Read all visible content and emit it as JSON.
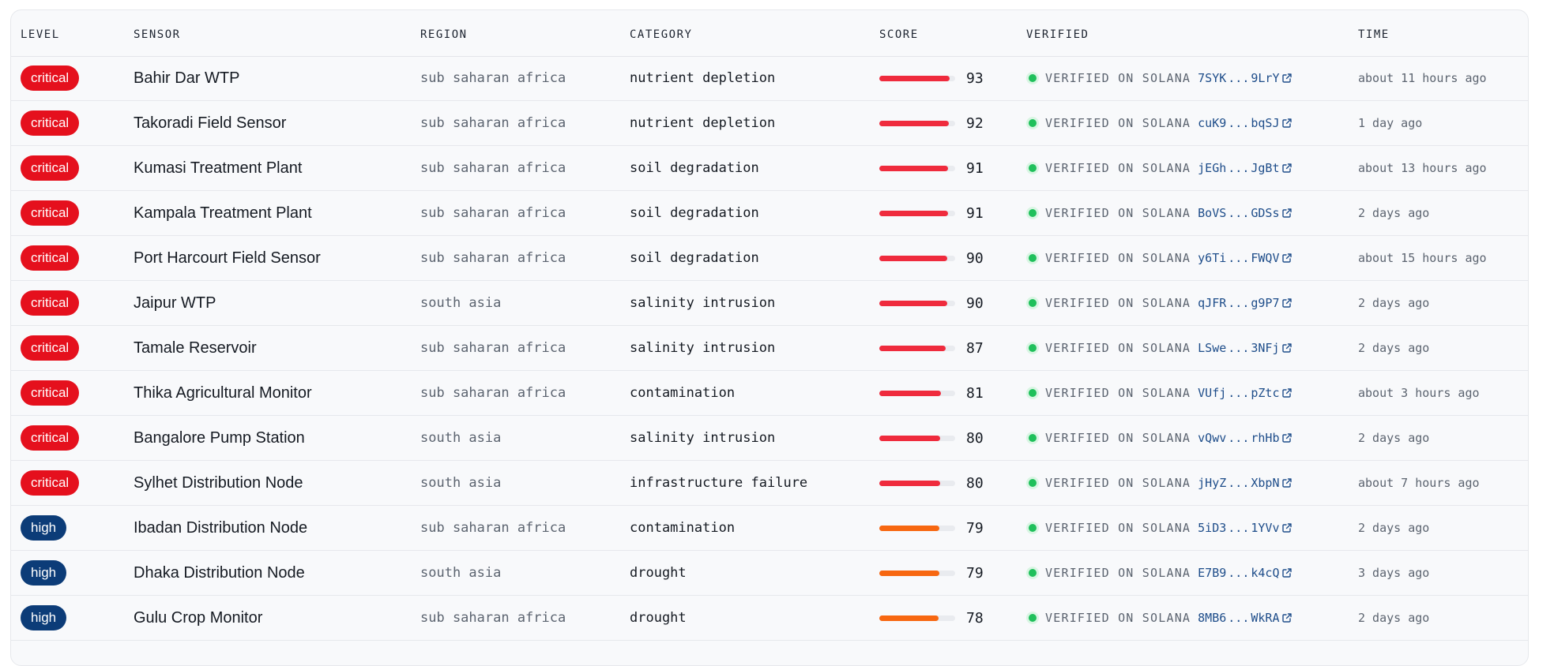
{
  "headers": {
    "level": "LEVEL",
    "sensor": "SENSOR",
    "region": "REGION",
    "category": "CATEGORY",
    "score": "SCORE",
    "verified": "VERIFIED",
    "time": "TIME"
  },
  "colors": {
    "critical_badge": "#e5101d",
    "high_badge": "#0c3c78",
    "critical_bar": "#ef2b3d",
    "high_bar": "#f76711",
    "verified_dot": "#1fc05b",
    "hash_link": "#1e4d8a"
  },
  "rows": [
    {
      "level": "critical",
      "sensor": "Bahir Dar WTP",
      "region": "sub saharan africa",
      "category": "nutrient depletion",
      "score": "93",
      "score_value": 93,
      "verified": "VERIFIED ON SOLANA",
      "hash_start": "7SYK",
      "hash_sep": "...",
      "hash_end": "9LrY",
      "link_icon": "external-link-icon",
      "time": "about 11 hours ago"
    },
    {
      "level": "critical",
      "sensor": "Takoradi Field Sensor",
      "region": "sub saharan africa",
      "category": "nutrient depletion",
      "score": "92",
      "score_value": 92,
      "verified": "VERIFIED ON SOLANA",
      "hash_start": "cuK9",
      "hash_sep": "...",
      "hash_end": "bqSJ",
      "link_icon": "external-link-icon",
      "time": "1 day ago"
    },
    {
      "level": "critical",
      "sensor": "Kumasi Treatment Plant",
      "region": "sub saharan africa",
      "category": "soil degradation",
      "score": "91",
      "score_value": 91,
      "verified": "VERIFIED ON SOLANA",
      "hash_start": "jEGh",
      "hash_sep": "...",
      "hash_end": "JgBt",
      "link_icon": "external-link-icon",
      "time": "about 13 hours ago"
    },
    {
      "level": "critical",
      "sensor": "Kampala Treatment Plant",
      "region": "sub saharan africa",
      "category": "soil degradation",
      "score": "91",
      "score_value": 91,
      "verified": "VERIFIED ON SOLANA",
      "hash_start": "BoVS",
      "hash_sep": "...",
      "hash_end": "GDSs",
      "link_icon": "external-link-icon",
      "time": "2 days ago"
    },
    {
      "level": "critical",
      "sensor": "Port Harcourt Field Sensor",
      "region": "sub saharan africa",
      "category": "soil degradation",
      "score": "90",
      "score_value": 90,
      "verified": "VERIFIED ON SOLANA",
      "hash_start": "y6Ti",
      "hash_sep": "...",
      "hash_end": "FWQV",
      "link_icon": "external-link-icon",
      "time": "about 15 hours ago"
    },
    {
      "level": "critical",
      "sensor": "Jaipur WTP",
      "region": "south asia",
      "category": "salinity intrusion",
      "score": "90",
      "score_value": 90,
      "verified": "VERIFIED ON SOLANA",
      "hash_start": "qJFR",
      "hash_sep": "...",
      "hash_end": "g9P7",
      "link_icon": "external-link-icon",
      "time": "2 days ago"
    },
    {
      "level": "critical",
      "sensor": "Tamale Reservoir",
      "region": "sub saharan africa",
      "category": "salinity intrusion",
      "score": "87",
      "score_value": 87,
      "verified": "VERIFIED ON SOLANA",
      "hash_start": "LSwe",
      "hash_sep": "...",
      "hash_end": "3NFj",
      "link_icon": "external-link-icon",
      "time": "2 days ago"
    },
    {
      "level": "critical",
      "sensor": "Thika Agricultural Monitor",
      "region": "sub saharan africa",
      "category": "contamination",
      "score": "81",
      "score_value": 81,
      "verified": "VERIFIED ON SOLANA",
      "hash_start": "VUfj",
      "hash_sep": "...",
      "hash_end": "pZtc",
      "link_icon": "external-link-icon",
      "time": "about 3 hours ago"
    },
    {
      "level": "critical",
      "sensor": "Bangalore Pump Station",
      "region": "south asia",
      "category": "salinity intrusion",
      "score": "80",
      "score_value": 80,
      "verified": "VERIFIED ON SOLANA",
      "hash_start": "vQwv",
      "hash_sep": "...",
      "hash_end": "rhHb",
      "link_icon": "external-link-icon",
      "time": "2 days ago"
    },
    {
      "level": "critical",
      "sensor": "Sylhet Distribution Node",
      "region": "south asia",
      "category": "infrastructure failure",
      "score": "80",
      "score_value": 80,
      "verified": "VERIFIED ON SOLANA",
      "hash_start": "jHyZ",
      "hash_sep": "...",
      "hash_end": "XbpN",
      "link_icon": "external-link-icon",
      "time": "about 7 hours ago"
    },
    {
      "level": "high",
      "sensor": "Ibadan Distribution Node",
      "region": "sub saharan africa",
      "category": "contamination",
      "score": "79",
      "score_value": 79,
      "verified": "VERIFIED ON SOLANA",
      "hash_start": "5iD3",
      "hash_sep": "...",
      "hash_end": "1YVv",
      "link_icon": "external-link-icon",
      "time": "2 days ago"
    },
    {
      "level": "high",
      "sensor": "Dhaka Distribution Node",
      "region": "south asia",
      "category": "drought",
      "score": "79",
      "score_value": 79,
      "verified": "VERIFIED ON SOLANA",
      "hash_start": "E7B9",
      "hash_sep": "...",
      "hash_end": "k4cQ",
      "link_icon": "external-link-icon",
      "time": "3 days ago"
    },
    {
      "level": "high",
      "sensor": "Gulu Crop Monitor",
      "region": "sub saharan africa",
      "category": "drought",
      "score": "78",
      "score_value": 78,
      "verified": "VERIFIED ON SOLANA",
      "hash_start": "8MB6",
      "hash_sep": "...",
      "hash_end": "WkRA",
      "link_icon": "external-link-icon",
      "time": "2 days ago"
    }
  ]
}
